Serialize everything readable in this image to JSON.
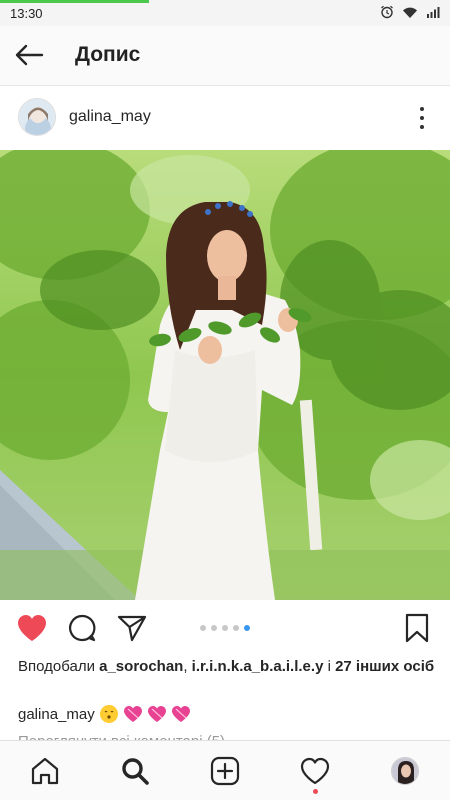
{
  "status_bar": {
    "time": "13:30",
    "icons": [
      "alarm-icon",
      "wifi-icon",
      "signal-icon",
      "battery-icon"
    ],
    "progress": 0.33
  },
  "header": {
    "back_icon": "arrow-left-icon",
    "title": "Допис"
  },
  "post": {
    "username": "galina_may",
    "more_icon": "more-vertical-icon",
    "carousel": {
      "count": 5,
      "active": 4
    },
    "likes_prefix": "Вподобали ",
    "liked_user_1": "a_sorochan",
    "likes_separator": ", ",
    "liked_user_2": "i.r.i.n.k.a_b.a.i.l.e.y",
    "likes_and": " і ",
    "likes_others": "27 інших осіб",
    "caption_user": "galina_may",
    "caption_emoji": [
      "kissing-face-emoji",
      "pink-heart-emoji",
      "pink-heart-emoji",
      "pink-heart-emoji"
    ],
    "comments_link": "Переглянути всі коментарі (5)"
  },
  "actions": [
    "like-heart-filled-icon",
    "comment-icon",
    "share-icon",
    "bookmark-icon"
  ],
  "bottom_nav": [
    "home-icon",
    "search-icon",
    "add-post-icon",
    "activity-heart-icon",
    "profile-avatar"
  ],
  "colors": {
    "like_red": "#ed4956",
    "carousel_active": "#3897f0",
    "status_progress": "#4cc94c"
  }
}
